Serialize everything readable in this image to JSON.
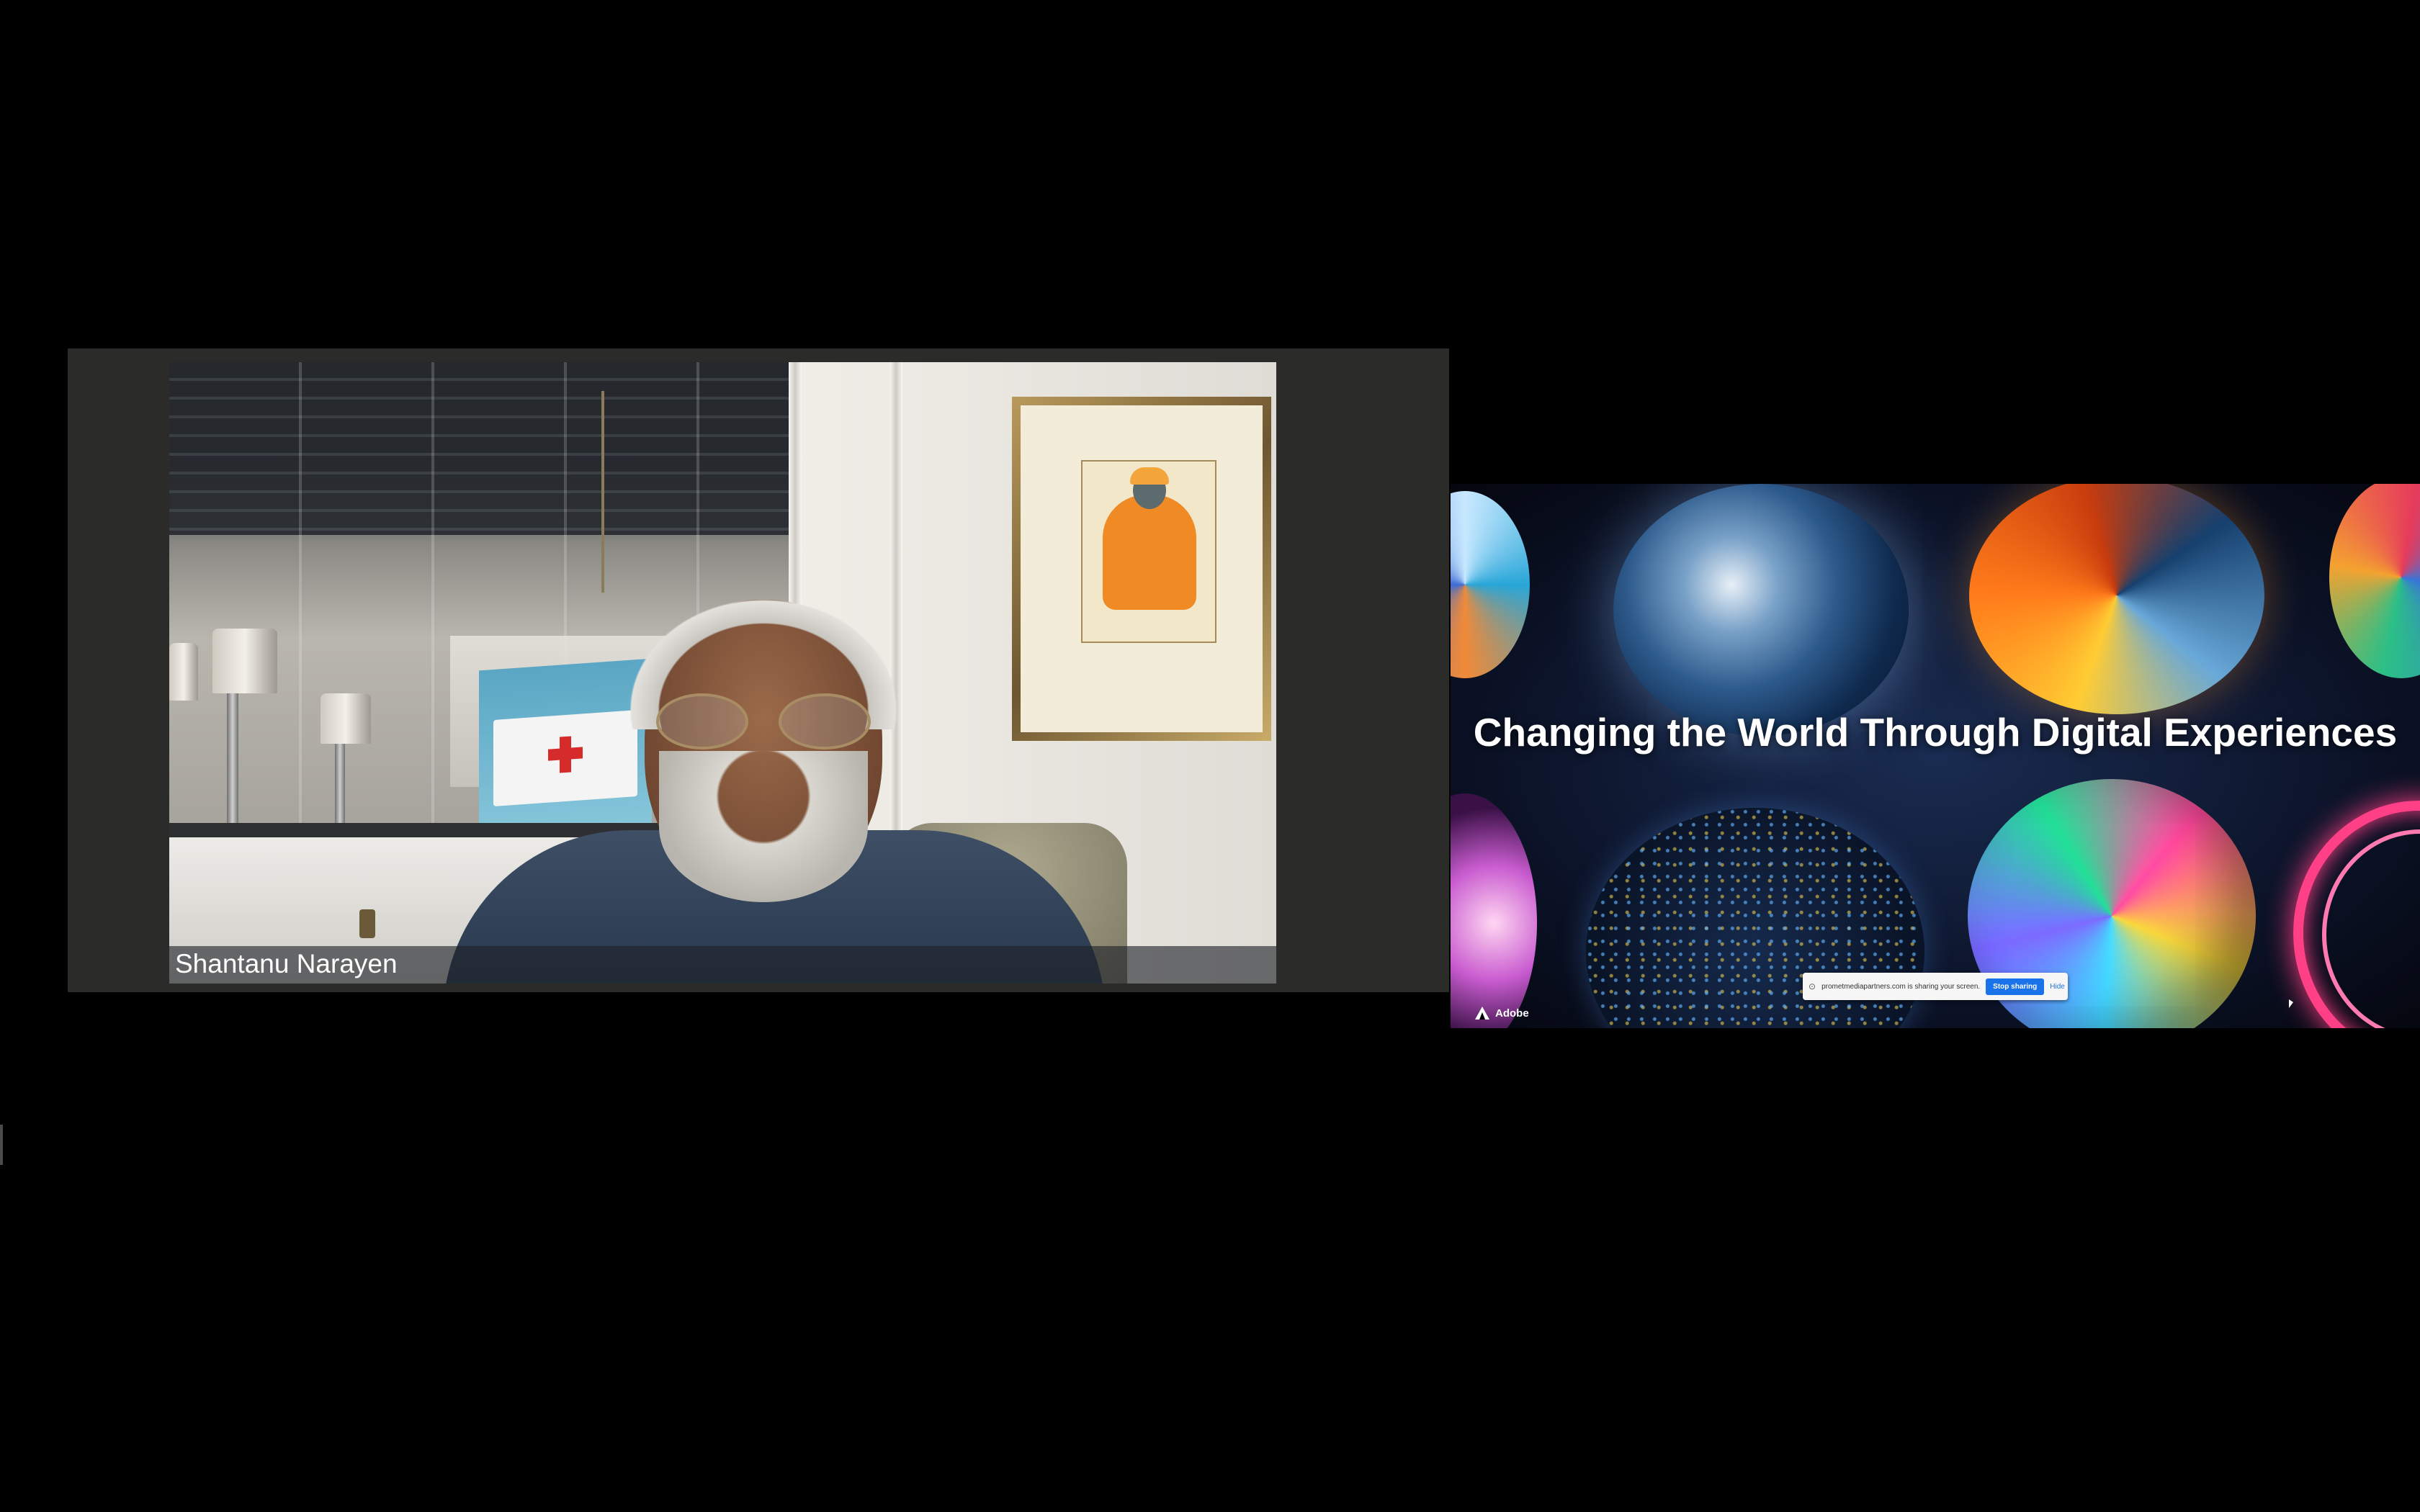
{
  "speaker": {
    "name": "Shantanu Narayen"
  },
  "shared_screen": {
    "title": "Changing the World Through Digital Experiences",
    "logo_text": "Adobe",
    "share_notice": {
      "text": "prometmediapartners.com is sharing your screen.",
      "stop_label": "Stop sharing",
      "hide_label": "Hide"
    }
  },
  "colors": {
    "background": "#000000",
    "tile_background": "#2b2b29",
    "stop_button": "#1a73e8"
  }
}
